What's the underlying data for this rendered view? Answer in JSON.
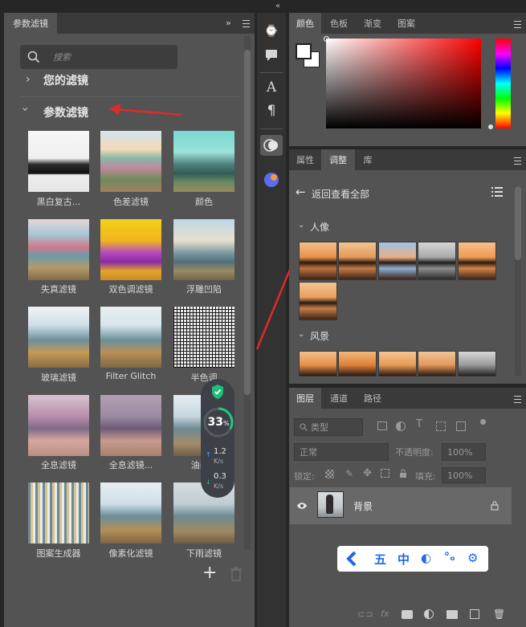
{
  "left_panel": {
    "tab_title": "参数滤镜",
    "search_placeholder": "搜索",
    "section_your_filters": "您的滤镜",
    "section_neural_filters": "参数滤镜",
    "filters": [
      {
        "label": "黑白复古..."
      },
      {
        "label": "色差滤镜"
      },
      {
        "label": "颜色"
      },
      {
        "label": "失真滤镜"
      },
      {
        "label": "双色调滤镜"
      },
      {
        "label": "浮雕凹陷"
      },
      {
        "label": "玻璃滤镜"
      },
      {
        "label": "Filter Glitch"
      },
      {
        "label": "半色调"
      },
      {
        "label": "全息滤镜"
      },
      {
        "label": "全息滤镜..."
      },
      {
        "label": "油画..."
      },
      {
        "label": "图案生成器"
      },
      {
        "label": "像素化滤镜"
      },
      {
        "label": "下雨滤镜"
      }
    ]
  },
  "speed_widget": {
    "percent": "33",
    "percent_unit": "%",
    "upload": "1.2",
    "upload_unit": "K/s",
    "download": "0.3",
    "download_unit": "K/s"
  },
  "color_panel": {
    "tabs": [
      "颜色",
      "色板",
      "渐变",
      "图案"
    ]
  },
  "adjust_panel": {
    "tabs": [
      "属性",
      "调整",
      "库"
    ],
    "back_label": "返回查看全部",
    "group1": "人像",
    "group2": "风景"
  },
  "layers_panel": {
    "tabs": [
      "图层",
      "通道",
      "路径"
    ],
    "filter_kind": "类型",
    "blend_mode": "正常",
    "opacity_label": "不透明度:",
    "opacity_value": "100%",
    "lock_label": "锁定:",
    "fill_label": "填充:",
    "fill_value": "100%",
    "layer_name": "背景"
  },
  "ime_toolbar": {
    "items": [
      "五",
      "中"
    ]
  }
}
